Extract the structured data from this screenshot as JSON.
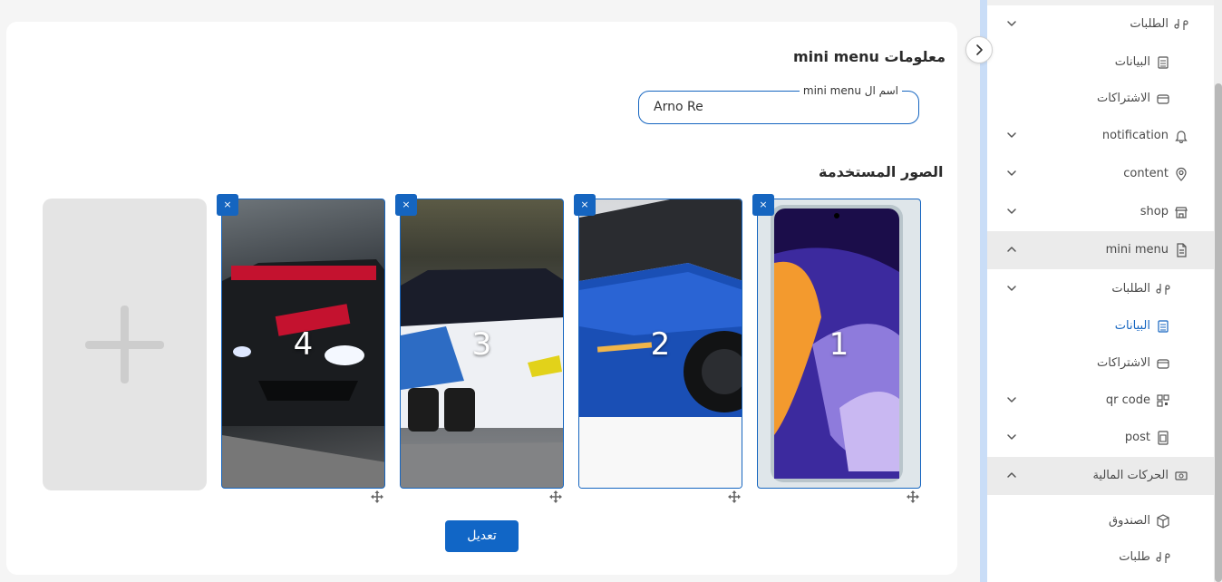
{
  "main": {
    "section_info_title": "معلومات mini menu",
    "name_field": {
      "label": "اسم ال mini menu",
      "value": "Arno Re"
    },
    "images_title": "الصور المستخدمة",
    "images": [
      {
        "number": "1",
        "subject": "phone"
      },
      {
        "number": "2",
        "subject": "blue-sports-car"
      },
      {
        "number": "3",
        "subject": "bmw-race-car"
      },
      {
        "number": "4",
        "subject": "bmw-race-car-night"
      }
    ],
    "close_glyph": "×",
    "save_label": "تعديل"
  },
  "sidebar": {
    "items": [
      {
        "label": "الطلبات",
        "icon": "orders-icon",
        "chevron": "down",
        "level": 1
      },
      {
        "label": "البيانات",
        "icon": "data-icon",
        "chevron": "",
        "level": 2
      },
      {
        "label": "الاشتراكات",
        "icon": "subscriptions-icon",
        "chevron": "",
        "level": 2
      },
      {
        "label": "notification",
        "icon": "bell-icon",
        "chevron": "down",
        "level": 1
      },
      {
        "label": "content",
        "icon": "location-icon",
        "chevron": "down",
        "level": 1
      },
      {
        "label": "shop",
        "icon": "store-icon",
        "chevron": "down",
        "level": 1
      },
      {
        "label": "mini menu",
        "icon": "document-icon",
        "chevron": "up",
        "level": 1,
        "active": true
      },
      {
        "label": "الطلبات",
        "icon": "orders-icon",
        "chevron": "down",
        "level": 2
      },
      {
        "label": "البيانات",
        "icon": "data-icon",
        "chevron": "",
        "level": 3,
        "selected": true
      },
      {
        "label": "الاشتراكات",
        "icon": "subscriptions-icon",
        "chevron": "",
        "level": 3
      },
      {
        "label": "qr code",
        "icon": "qr-icon",
        "chevron": "down",
        "level": 2
      },
      {
        "label": "post",
        "icon": "post-icon",
        "chevron": "down",
        "level": 2
      },
      {
        "label": "الحركات المالية",
        "icon": "money-icon",
        "chevron": "up",
        "level": 1,
        "active": true
      },
      {
        "label": "الصندوق",
        "icon": "box-icon",
        "chevron": "",
        "level": 2
      },
      {
        "label": "طلبات",
        "icon": "orders-icon",
        "chevron": "",
        "level": 2
      }
    ]
  },
  "colors": {
    "accent": "#1565c0",
    "active_bg": "#ebebeb",
    "page_bg": "#f5f5f5"
  }
}
